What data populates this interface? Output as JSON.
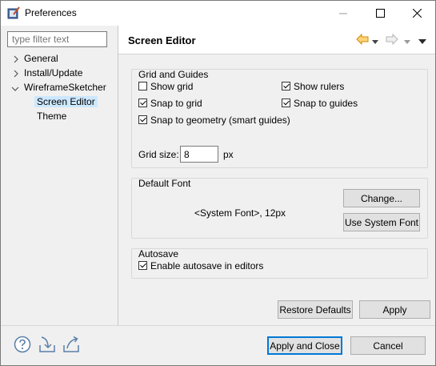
{
  "window": {
    "title": "Preferences"
  },
  "filter": {
    "placeholder": "type filter text"
  },
  "tree": {
    "items": [
      {
        "label": "General"
      },
      {
        "label": "Install/Update"
      },
      {
        "label": "WireframeSketcher"
      },
      {
        "label": "Screen Editor"
      },
      {
        "label": "Theme"
      }
    ]
  },
  "page": {
    "title": "Screen Editor"
  },
  "grid_guides": {
    "title": "Grid and Guides",
    "show_grid": {
      "label": "Show grid",
      "checked": false
    },
    "show_rulers": {
      "label": "Show rulers",
      "checked": true
    },
    "snap_grid": {
      "label": "Snap to grid",
      "checked": true
    },
    "snap_guides": {
      "label": "Snap to guides",
      "checked": true
    },
    "snap_geometry": {
      "label": "Snap to geometry (smart guides)",
      "checked": true
    },
    "grid_size_label": "Grid size:",
    "grid_size_value": "8",
    "grid_size_unit": "px"
  },
  "default_font": {
    "title": "Default Font",
    "value": "<System Font>, 12px",
    "change_label": "Change...",
    "use_system_label": "Use System Font"
  },
  "autosave": {
    "title": "Autosave",
    "enable": {
      "label": "Enable autosave in editors",
      "checked": true
    }
  },
  "buttons": {
    "restore_defaults": "Restore Defaults",
    "apply": "Apply",
    "apply_close": "Apply and Close",
    "cancel": "Cancel"
  },
  "icons": {
    "app": "preferences-app-icon",
    "back": "back-arrow-icon",
    "forward": "forward-arrow-icon",
    "help": "help-icon",
    "import": "import-icon",
    "export": "export-icon"
  },
  "colors": {
    "accent": "#0078d7",
    "selection": "#cce8ff",
    "arrow": "#e8a000"
  }
}
